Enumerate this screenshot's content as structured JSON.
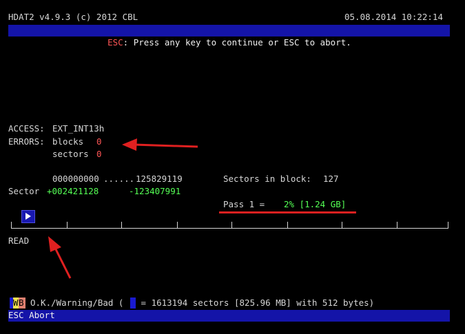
{
  "header": {
    "app_title": "HDAT2 v4.9.3 (c) 2012 CBL",
    "datetime": "05.08.2014 10:22:14"
  },
  "prompt": {
    "key": "ESC",
    "message": ": Press any key to continue or ESC to abort."
  },
  "info": {
    "access_label": "ACCESS:",
    "access_value": "EXT_INT13h",
    "errors_label": "ERRORS:",
    "blocks_label": "blocks",
    "blocks_value": "0",
    "sectors_label": "sectors",
    "sectors_value": "0"
  },
  "range": {
    "start": "000000000",
    "dots": "......",
    "end": "125829119",
    "sectors_in_block_label": "Sectors in block:",
    "sectors_in_block_value": "127",
    "sector_label": "Sector",
    "sector_current": "+002421128",
    "sector_remaining": "-123407991"
  },
  "pass": {
    "label": "Pass 1 =",
    "progress": "2% [1.24 GB]",
    "fraction": 0.02
  },
  "mode": "READ",
  "legend": {
    "o_glyph": "W",
    "b_glyph": "B",
    "label_left": "O.K./Warning/Bad (",
    "label_right": " = 1613194 sectors [825.96 MB] with 512 bytes)"
  },
  "footer": {
    "esc_label": "ESC Abort"
  },
  "colors": {
    "bar_blue": "#1414a8",
    "error_red": "#ff5555",
    "ok_green": "#55ff55",
    "annotation_red": "#e02020"
  },
  "icons": {
    "cursor": "play-arrow-icon",
    "annotation": "arrow-icon"
  }
}
